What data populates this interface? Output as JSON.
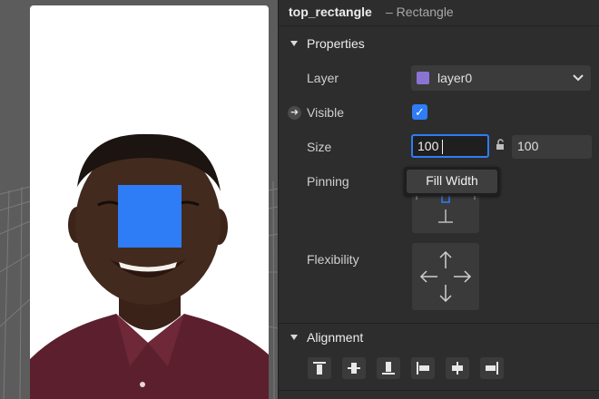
{
  "inspector": {
    "object_name": "top_rectangle",
    "object_type": "– Rectangle",
    "properties": {
      "title": "Properties",
      "layer_label": "Layer",
      "layer_value": "layer0",
      "layer_color": "#8b73d4",
      "visible_label": "Visible",
      "visible_checked": true,
      "size_label": "Size",
      "size_width": "100",
      "size_height": "100",
      "pinning_label": "Pinning",
      "tooltip": "Fill Width",
      "flexibility_label": "Flexibility"
    },
    "alignment": {
      "title": "Alignment",
      "buttons": [
        "align-top",
        "align-vertical-center",
        "align-bottom",
        "align-left",
        "align-horizontal-center",
        "align-right"
      ]
    }
  },
  "colors": {
    "accent": "#2f7df6",
    "panel_bg": "#2d2d2d",
    "viewport_bg": "#5c5c5c",
    "rect_fill": "#2f7df6"
  },
  "icons": {
    "visible_arrow": "➜",
    "checkmark": "✓"
  }
}
